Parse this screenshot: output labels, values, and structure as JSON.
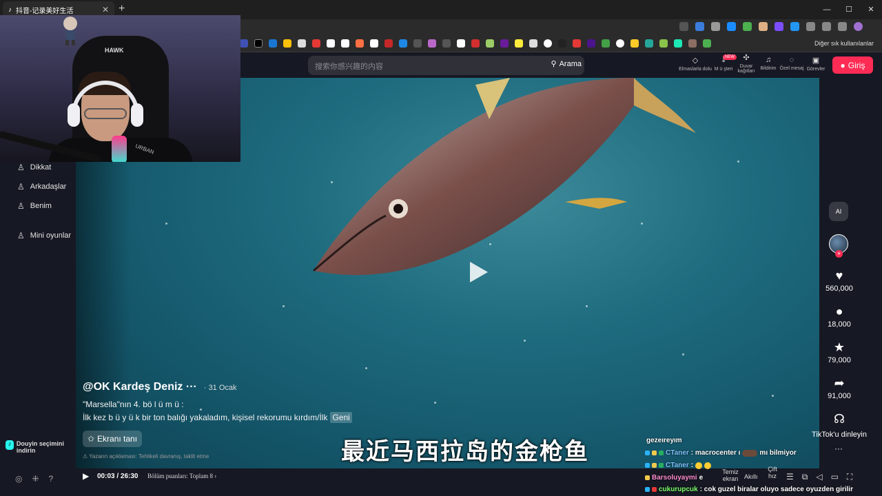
{
  "browser": {
    "tab_title": "抖音-记录美好生活",
    "new_tab": "+",
    "window_controls": [
      "—",
      "☐",
      "✕"
    ],
    "bookmarks_other": "Diğer sık kullanılanlar"
  },
  "header": {
    "search_placeholder": "搜索你感兴趣的内容",
    "search_button": "Arama",
    "items": [
      {
        "label": "Elmaslarla dolu",
        "icon": "diamond-icon"
      },
      {
        "label": "M ü şteri",
        "icon": "download-icon"
      },
      {
        "label": "Duvar kağıtları",
        "icon": "wallpaper-icon"
      },
      {
        "label": "Bildirim",
        "icon": "bell-icon"
      },
      {
        "label": "Özel mesaj",
        "icon": "message-icon"
      },
      {
        "label": "Görevler",
        "icon": "tasks-icon"
      }
    ],
    "new_badge": "NEW",
    "login": "Giriş"
  },
  "sidebar": {
    "items": [
      {
        "label": "Dikkat",
        "icon": "follow-icon"
      },
      {
        "label": "Arkadaşlar",
        "icon": "friends-icon"
      },
      {
        "label": "Benim",
        "icon": "profile-icon"
      },
      {
        "label": "Mini oyunlar",
        "icon": "games-icon"
      }
    ],
    "download": "Douyin seçimini indirin"
  },
  "video": {
    "author": "@OK Kardeş Deniz ···",
    "date": "· 31 Ocak",
    "desc_line1": "\"Marsella\"nın 4. bö l ü m ü :",
    "desc_line2": "İlk kez b ü y ü k bir ton balığı yakaladım, kişisel rekorumu kırdım/İlk",
    "desc_more": "Geni",
    "recognize_button": "Ekranı tanı",
    "disclaimer": "Yazarın açıklaması: Tehlikeli davranış, taklit etme",
    "subtitle": "最近马西拉岛的金枪鱼"
  },
  "rail": {
    "ai_label": "AI",
    "likes": "560,000",
    "comments": "18,000",
    "favorites": "79,000",
    "shares": "91,000",
    "listen": "TikTok'u dinleyin",
    "more": "···"
  },
  "player": {
    "time": "00:03 / 26:30",
    "episodes": "Bölüm puanları: Toplam 8",
    "clean_screen": "Temiz ekran",
    "smart": "Akıllı",
    "double_speed": "Çift hız"
  },
  "chat": {
    "header": "gezeıreyım",
    "lines": [
      {
        "user": "CTaner",
        "message": ": macrocenter ı",
        "tail": "mı bilmiyor"
      },
      {
        "user": "CTaner",
        "message": ":"
      },
      {
        "user": "Barsoluyaymi",
        "message": "e"
      },
      {
        "user": "cukurupcuk",
        "message": ": cok guzel biralar oluyo sadece oyuzden girilir"
      }
    ]
  },
  "webcam": {
    "chair_brand": "HAWK",
    "shirt_text": "URBAN"
  }
}
